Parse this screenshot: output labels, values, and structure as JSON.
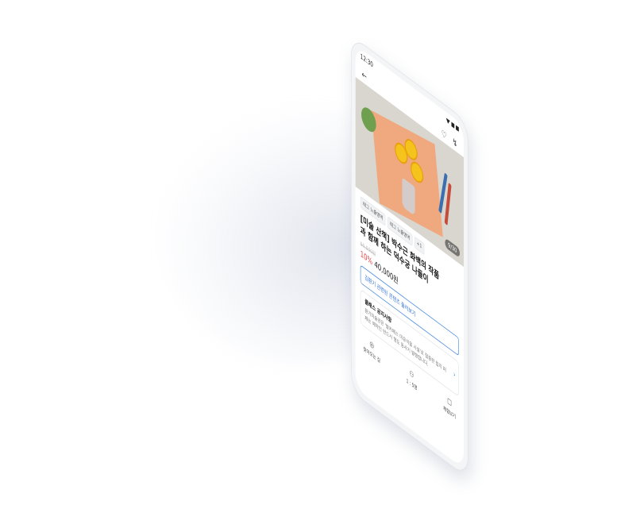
{
  "status": {
    "time": "12:30"
  },
  "topbar": {
    "back_icon": "arrow-left-icon",
    "like_icon": "heart-icon",
    "share_icon": "share-icon"
  },
  "hero": {
    "counter": "9/30"
  },
  "tags": [
    "태그 노출영역",
    "태그 노출영역",
    "+1"
  ],
  "product": {
    "title_line1": "[미술 산책] 박수근 화백의 작품",
    "title_line2": "과 함께 하는 덕수궁 나들이",
    "original_price": "50,000원",
    "discount": "10%",
    "price": "40,000원"
  },
  "cta": {
    "label": "김환기 관련된 콘텐츠 둘러보기"
  },
  "notice": {
    "heading": "클래스 공지사항",
    "body": "환기미술관은 '발카페스 미유석을 시설'로 협중판 립지 퍼페는 예약인 반드시 행도 동사기 발행합니다."
  },
  "bottom": [
    {
      "icon": "location-pin-icon",
      "label": "찾아오는 길"
    },
    {
      "icon": "people-icon",
      "label": "1 : 5명"
    },
    {
      "icon": "trophy-icon",
      "label": "체험보기"
    }
  ],
  "colors": {
    "accent": "#3f86e0",
    "discount": "#e5373a"
  }
}
